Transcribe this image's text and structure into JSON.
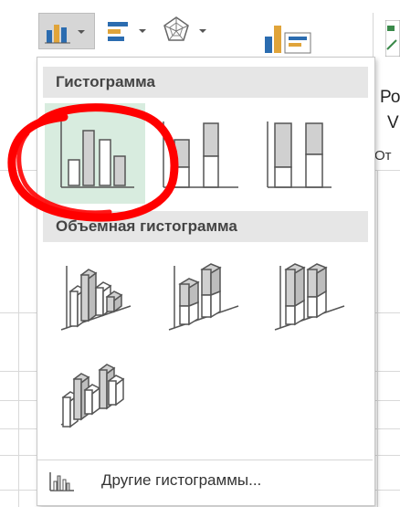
{
  "ribbon": {
    "buttons": [
      {
        "icon": "column-chart-icon",
        "has_dropdown": true
      },
      {
        "icon": "bar-chart-icon",
        "has_dropdown": true
      },
      {
        "icon": "radar-chart-icon",
        "has_dropdown": true
      },
      {
        "icon": "recommended-charts-icon",
        "has_dropdown": false
      }
    ],
    "side_texts": [
      "Ро",
      "V",
      "От"
    ]
  },
  "menu": {
    "section_2d_title": "Гистограмма",
    "section_3d_title": "Объемная гистограмма",
    "tiles_2d": [
      {
        "name": "clustered-column",
        "selected": true
      },
      {
        "name": "stacked-column",
        "selected": false
      },
      {
        "name": "100-stacked-column",
        "selected": false
      }
    ],
    "tiles_3d": [
      {
        "name": "3d-clustered-column"
      },
      {
        "name": "3d-stacked-column"
      },
      {
        "name": "3d-100-stacked-column"
      },
      {
        "name": "3d-column"
      }
    ],
    "more_label": "Другие гистограммы..."
  },
  "colors": {
    "selection_bg": "#d8ecdf",
    "highlight_ring": "#ff0000",
    "section_header_bg": "#e6e6e6",
    "bar_fill": "#d0d0d0",
    "bar_outline": "#555555",
    "ribbon_icon_blue": "#2b6cb0",
    "ribbon_icon_gold": "#e0a43a"
  }
}
